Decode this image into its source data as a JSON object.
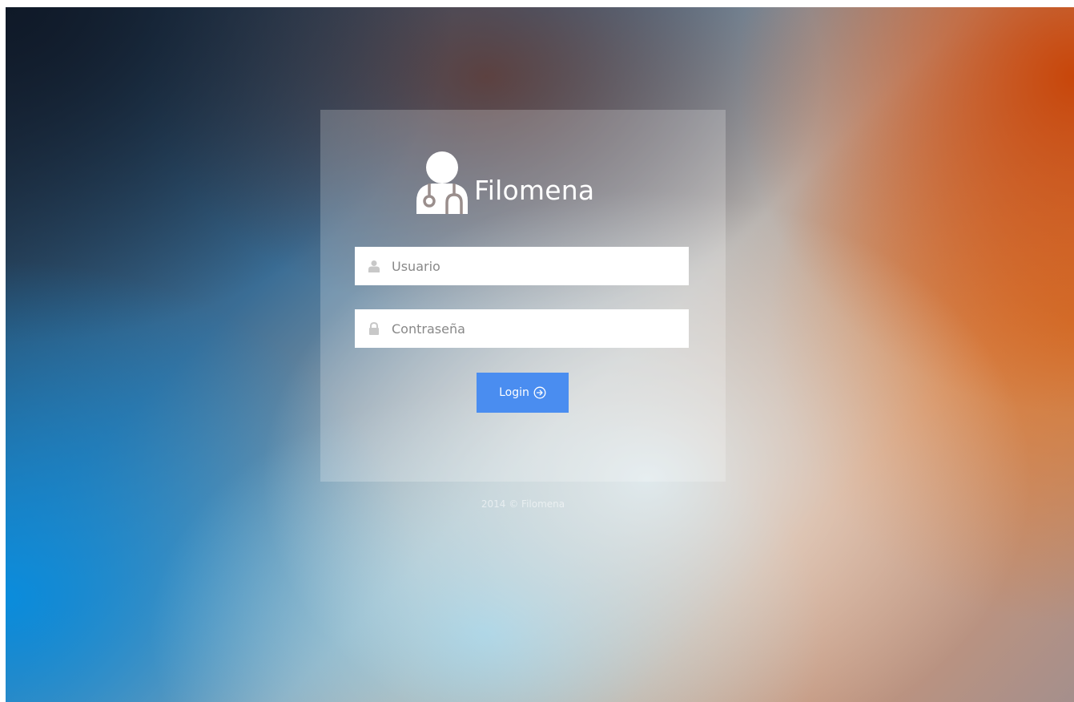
{
  "app": {
    "brand_name": "Filomena",
    "logo_icon": "doctor-stethoscope-icon"
  },
  "login_form": {
    "username": {
      "placeholder": "Usuario",
      "value": "",
      "icon": "user-icon"
    },
    "password": {
      "placeholder": "Contraseña",
      "value": "",
      "icon": "lock-icon"
    },
    "submit": {
      "label": "Login",
      "icon": "arrow-circle-right-icon"
    }
  },
  "footer": {
    "text": "2014 © Filomena"
  },
  "colors": {
    "accent": "#4a8df0",
    "field_background": "#ffffff",
    "text_on_card": "#ffffff"
  }
}
